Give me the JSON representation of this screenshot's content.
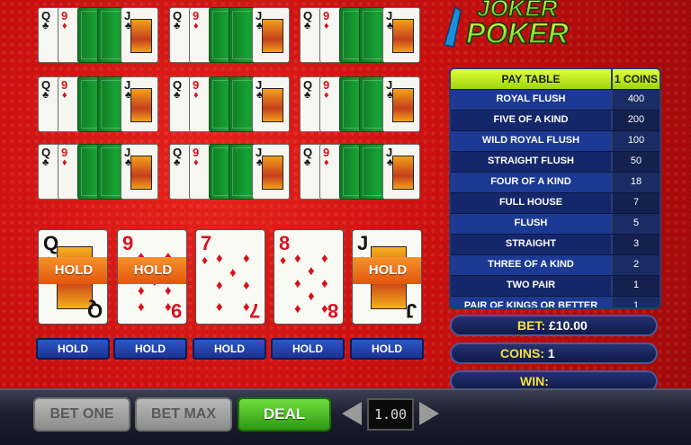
{
  "logo": {
    "line1": "JOKER",
    "line2": "POKER"
  },
  "mini_hands": [
    {
      "cards": [
        {
          "rank": "Q",
          "suit": "♣",
          "color": "black"
        },
        {
          "rank": "9",
          "suit": "♦",
          "color": "red"
        },
        {
          "back": true
        },
        {
          "back": true
        },
        {
          "rank": "J",
          "suit": "♣",
          "color": "black"
        }
      ]
    },
    {
      "cards": [
        {
          "rank": "Q",
          "suit": "♣",
          "color": "black"
        },
        {
          "rank": "9",
          "suit": "♦",
          "color": "red"
        },
        {
          "back": true
        },
        {
          "back": true
        },
        {
          "rank": "J",
          "suit": "♣",
          "color": "black"
        }
      ]
    },
    {
      "cards": [
        {
          "rank": "Q",
          "suit": "♣",
          "color": "black"
        },
        {
          "rank": "9",
          "suit": "♦",
          "color": "red"
        },
        {
          "back": true
        },
        {
          "back": true
        },
        {
          "rank": "J",
          "suit": "♣",
          "color": "black"
        }
      ]
    },
    {
      "cards": [
        {
          "rank": "Q",
          "suit": "♣",
          "color": "black"
        },
        {
          "rank": "9",
          "suit": "♦",
          "color": "red"
        },
        {
          "back": true
        },
        {
          "back": true
        },
        {
          "rank": "J",
          "suit": "♣",
          "color": "black"
        }
      ]
    },
    {
      "cards": [
        {
          "rank": "Q",
          "suit": "♣",
          "color": "black"
        },
        {
          "rank": "9",
          "suit": "♦",
          "color": "red"
        },
        {
          "back": true
        },
        {
          "back": true
        },
        {
          "rank": "J",
          "suit": "♣",
          "color": "black"
        }
      ]
    },
    {
      "cards": [
        {
          "rank": "Q",
          "suit": "♣",
          "color": "black"
        },
        {
          "rank": "9",
          "suit": "♦",
          "color": "red"
        },
        {
          "back": true
        },
        {
          "back": true
        },
        {
          "rank": "J",
          "suit": "♣",
          "color": "black"
        }
      ]
    },
    {
      "cards": [
        {
          "rank": "Q",
          "suit": "♣",
          "color": "black"
        },
        {
          "rank": "9",
          "suit": "♦",
          "color": "red"
        },
        {
          "back": true
        },
        {
          "back": true
        },
        {
          "rank": "J",
          "suit": "♣",
          "color": "black"
        }
      ]
    },
    {
      "cards": [
        {
          "rank": "Q",
          "suit": "♣",
          "color": "black"
        },
        {
          "rank": "9",
          "suit": "♦",
          "color": "red"
        },
        {
          "back": true
        },
        {
          "back": true
        },
        {
          "rank": "J",
          "suit": "♣",
          "color": "black"
        }
      ]
    },
    {
      "cards": [
        {
          "rank": "Q",
          "suit": "♣",
          "color": "black"
        },
        {
          "rank": "9",
          "suit": "♦",
          "color": "red"
        },
        {
          "back": true
        },
        {
          "back": true
        },
        {
          "rank": "J",
          "suit": "♣",
          "color": "black"
        }
      ]
    }
  ],
  "paytable": {
    "header": "PAY TABLE",
    "coins_header": "1 COINS",
    "rows": [
      {
        "name": "ROYAL FLUSH",
        "value": "400"
      },
      {
        "name": "FIVE OF A KIND",
        "value": "200"
      },
      {
        "name": "WILD ROYAL FLUSH",
        "value": "100"
      },
      {
        "name": "STRAIGHT FLUSH",
        "value": "50"
      },
      {
        "name": "FOUR OF A KIND",
        "value": "18"
      },
      {
        "name": "FULL HOUSE",
        "value": "7"
      },
      {
        "name": "FLUSH",
        "value": "5"
      },
      {
        "name": "STRAIGHT",
        "value": "3"
      },
      {
        "name": "THREE OF A KIND",
        "value": "2"
      },
      {
        "name": "TWO PAIR",
        "value": "1"
      },
      {
        "name": "PAIR OF KINGS OR BETTER",
        "value": "1"
      }
    ]
  },
  "info": {
    "bet_label": "BET:",
    "bet_value": "£10.00",
    "coins_label": "COINS:",
    "coins_value": "1",
    "win_label": "WIN:",
    "win_value": ""
  },
  "main_hand": [
    {
      "rank": "Q",
      "suit": "♣",
      "color": "black",
      "face": true,
      "held": true
    },
    {
      "rank": "9",
      "suit": "♦",
      "color": "red",
      "face": false,
      "held": true
    },
    {
      "rank": "7",
      "suit": "♦",
      "color": "red",
      "face": false,
      "held": false
    },
    {
      "rank": "8",
      "suit": "♦",
      "color": "red",
      "face": false,
      "held": false
    },
    {
      "rank": "J",
      "suit": "♣",
      "color": "black",
      "face": true,
      "held": true
    }
  ],
  "hold_flag_label": "HOLD",
  "hold_button_label": "HOLD",
  "controls": {
    "bet_one": "BET ONE",
    "bet_max": "BET MAX",
    "deal": "DEAL",
    "coin_value": "1.00"
  },
  "colors": {
    "table_accent": "#b8e61c",
    "deal_green": "#3fb81f",
    "hold_orange": "#f07a1c"
  }
}
